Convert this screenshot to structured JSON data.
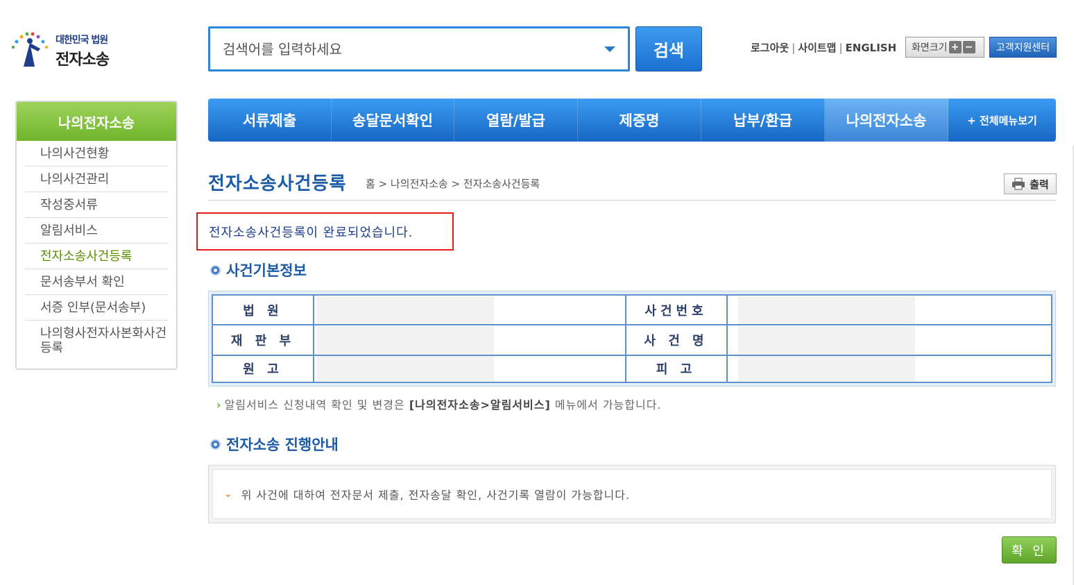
{
  "logo": {
    "line1": "대한민국 법원",
    "line2": "전자소송"
  },
  "search": {
    "placeholder": "검색어를 입력하세요",
    "button": "검색"
  },
  "util": {
    "logout": "로그아웃",
    "sitemap": "사이트맵",
    "english": "ENGLISH",
    "font_size": "화면크기",
    "plus": "+",
    "minus": "−",
    "customer_center": "고객지원센터"
  },
  "sidebar": {
    "title": "나의전자소송",
    "items": [
      {
        "label": "나의사건현황"
      },
      {
        "label": "나의사건관리"
      },
      {
        "label": "작성중서류"
      },
      {
        "label": "알림서비스"
      },
      {
        "label": "전자소송사건등록"
      },
      {
        "label": "문서송부서 확인"
      },
      {
        "label": "서증 인부(문서송부)"
      },
      {
        "label": "나의형사전자사본화사건등록"
      }
    ]
  },
  "gnb": {
    "items": [
      {
        "label": "서류제출"
      },
      {
        "label": "송달문서확인"
      },
      {
        "label": "열람/발급"
      },
      {
        "label": "제증명"
      },
      {
        "label": "납부/환급"
      },
      {
        "label": "나의전자소송"
      },
      {
        "label": "+ 전체메뉴보기"
      }
    ]
  },
  "page": {
    "title": "전자소송사건등록",
    "breadcrumb": "홈 > 나의전자소송 > 전자소송사건등록",
    "print": "출력",
    "done_message": "전자소송사건등록이 완료되었습니다."
  },
  "case_info": {
    "title": "사건기본정보",
    "labels": {
      "court": "법 원",
      "division": "재 판 부",
      "plaintiff": "원 고",
      "case_no": "사건번호",
      "case_name": "사 건 명",
      "defendant": "피 고"
    }
  },
  "note": {
    "prefix": "알림서비스 신청내역 확인 및 변경은 ",
    "highlight": "[나의전자소송>알림서비스]",
    "suffix": " 메뉴에서 가능합니다."
  },
  "guide": {
    "title": "전자소송 진행안내",
    "text": "위 사건에 대하여 전자문서 제출, 전자송달 확인, 사건기록 열람이 가능합니다."
  },
  "confirm": "확 인"
}
